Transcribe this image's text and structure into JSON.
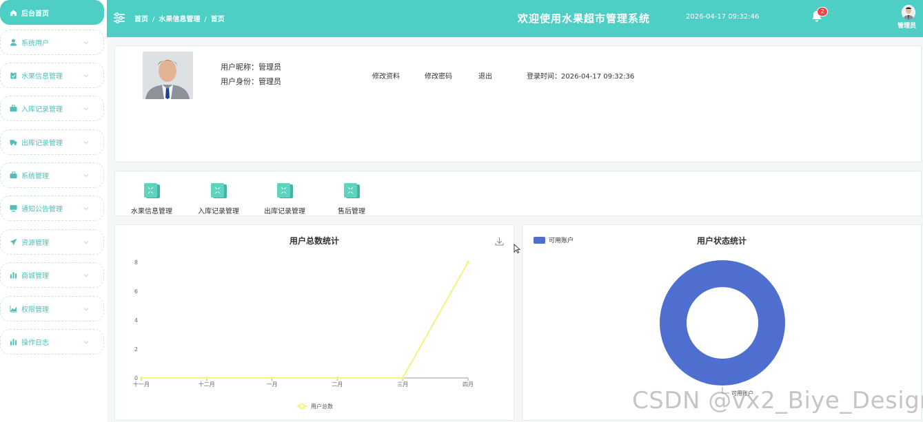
{
  "sidebar": {
    "items": [
      {
        "label": "后台首页",
        "icon": "home-icon",
        "active": true
      },
      {
        "label": "系统用户",
        "icon": "user-icon"
      },
      {
        "label": "水果信息管理",
        "icon": "clipboard-icon"
      },
      {
        "label": "入库记录管理",
        "icon": "briefcase-icon"
      },
      {
        "label": "出库记录管理",
        "icon": "truck-icon"
      },
      {
        "label": "系统管理",
        "icon": "briefcase-icon"
      },
      {
        "label": "通知公告管理",
        "icon": "monitor-icon"
      },
      {
        "label": "资源管理",
        "icon": "send-icon"
      },
      {
        "label": "商城管理",
        "icon": "bar-chart-icon"
      },
      {
        "label": "权限管理",
        "icon": "area-chart-icon"
      },
      {
        "label": "操作日志",
        "icon": "bar-chart-icon"
      }
    ]
  },
  "header": {
    "breadcrumb": [
      "首页",
      "水果信息管理",
      "首页"
    ],
    "title": "欢迎使用水果超市管理系统",
    "datetime": "2026-04-17 09:32:46",
    "notification_count": "2",
    "username": "管理员"
  },
  "profile": {
    "nickname_label": "用户昵称：",
    "nickname": "管理员",
    "role_label": "用户身份：",
    "role": "管理员",
    "edit_profile": "修改资料",
    "change_password": "修改密码",
    "logout": "退出",
    "login_time_label": "登录时间：",
    "login_time": "2026-04-17 09:32:36"
  },
  "quick_links": [
    "水果信息管理",
    "入库记录管理",
    "出库记录管理",
    "售后管理"
  ],
  "colors": {
    "accent": "#4ecfc6",
    "line": "#f7f27a",
    "donut": "#4e6fcf"
  },
  "chart_data": [
    {
      "type": "line",
      "title": "用户总数统计",
      "categories": [
        "十一月",
        "十二月",
        "一月",
        "二月",
        "三月",
        "四月"
      ],
      "series": [
        {
          "name": "用户总数",
          "values": [
            0,
            0,
            0,
            0,
            0,
            8
          ]
        }
      ],
      "ylim": [
        0,
        8
      ],
      "yticks": [
        0,
        2,
        4,
        6,
        8
      ],
      "grid": false,
      "legend": "bottom"
    },
    {
      "type": "pie",
      "title": "用户状态统计",
      "donut": true,
      "slices": [
        {
          "label": "可用账户",
          "value": 1
        }
      ],
      "legend": "top-left"
    }
  ],
  "watermark": "CSDN @vx2_Biye_Design"
}
